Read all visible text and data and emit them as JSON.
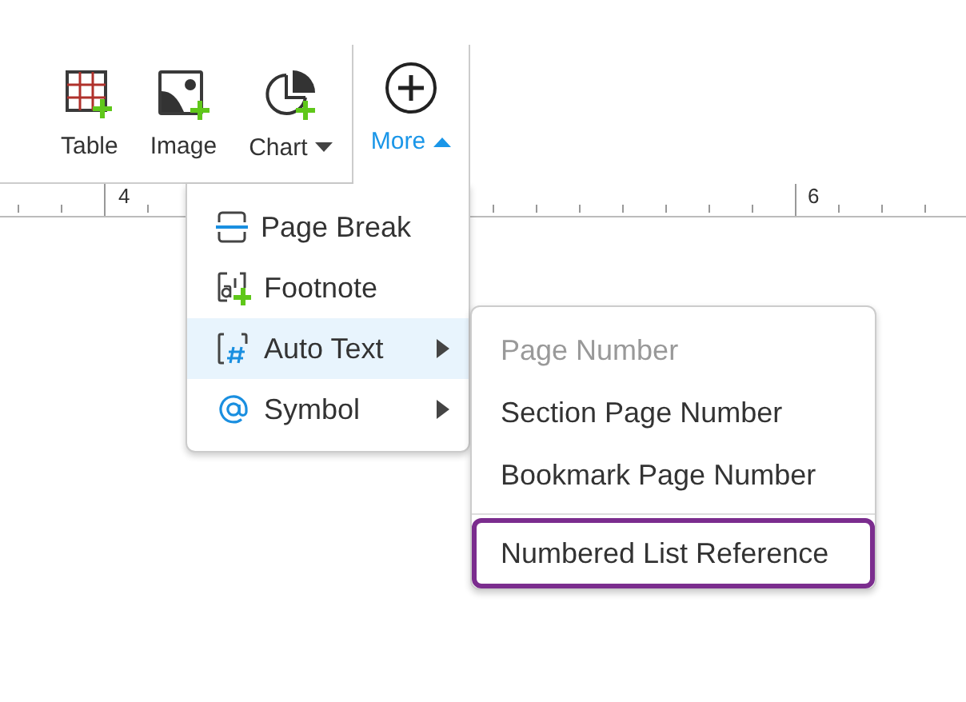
{
  "toolbar": {
    "buttons": [
      {
        "label": "Table",
        "kind": "table",
        "dropdown": false,
        "selected": false
      },
      {
        "label": "Image",
        "kind": "image",
        "dropdown": false,
        "selected": false
      },
      {
        "label": "Chart",
        "kind": "chart",
        "dropdown": true,
        "selected": false
      },
      {
        "label": "More",
        "kind": "more",
        "dropdown": true,
        "selected": true
      }
    ]
  },
  "ruler": {
    "labels": [
      "4",
      "6"
    ]
  },
  "menu": {
    "items": [
      {
        "label": "Page Break",
        "kind": "page-break",
        "submenu": false,
        "selected": false
      },
      {
        "label": "Footnote",
        "kind": "footnote",
        "submenu": false,
        "selected": false
      },
      {
        "label": "Auto Text",
        "kind": "auto-text",
        "submenu": true,
        "selected": true
      },
      {
        "label": "Symbol",
        "kind": "symbol",
        "submenu": true,
        "selected": false
      }
    ]
  },
  "submenu": {
    "items": [
      {
        "label": "Page Number",
        "disabled": true,
        "divider_before": false,
        "selected": false
      },
      {
        "label": "Section Page Number",
        "disabled": false,
        "divider_before": false,
        "selected": false
      },
      {
        "label": "Bookmark Page Number",
        "disabled": false,
        "divider_before": false,
        "selected": false
      },
      {
        "label": "Numbered List Reference",
        "disabled": false,
        "divider_before": true,
        "selected": true
      }
    ]
  }
}
